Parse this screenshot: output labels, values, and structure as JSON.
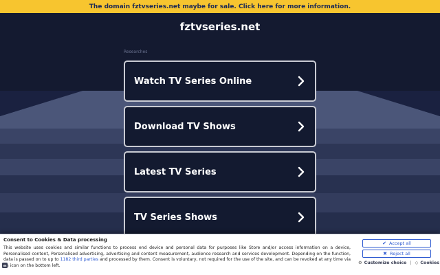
{
  "banner": {
    "text": "The domain fztvseries.net maybe for sale. Click here for more information."
  },
  "site": {
    "title": "fztvseries.net"
  },
  "researches_label": "Researches",
  "links": [
    {
      "label": "Watch TV Series Online"
    },
    {
      "label": "Download TV Shows"
    },
    {
      "label": "Latest TV Series"
    },
    {
      "label": "TV Series Shows"
    }
  ],
  "consent": {
    "title": "Consent to Cookies & Data processing",
    "text_before": "This website uses cookies and similar functions to process end device and personal data for purposes like Store and/or access information on a device, Personalised content, Personalised advertising, advertising and content measurement, audience research and services development. Depending on the function, data is passed on to up to ",
    "third_parties_link": "1182 third parties",
    "text_after": " and processed by them. Consent is voluntary, not required for the use of the site, and can be revoked at any time via an icon on the bottom left.",
    "accept_label": "Accept all",
    "reject_label": "Reject all",
    "customize_label": "Customize choice",
    "separator": "|",
    "cookies_label": "Cookies"
  },
  "colors": {
    "banner_bg": "#f7c52f",
    "banner_text": "#1d2a54",
    "page_bg": "#141a30",
    "button_border": "#c9cbd3",
    "link_blue": "#2f5bd1"
  },
  "icons": {
    "chevron": "chevron-right-icon",
    "accept": "checkmark-icon",
    "reject": "cross-icon",
    "customize": "gear-icon",
    "cookies": "diamond-icon",
    "privacy": "fingerprint-icon"
  }
}
